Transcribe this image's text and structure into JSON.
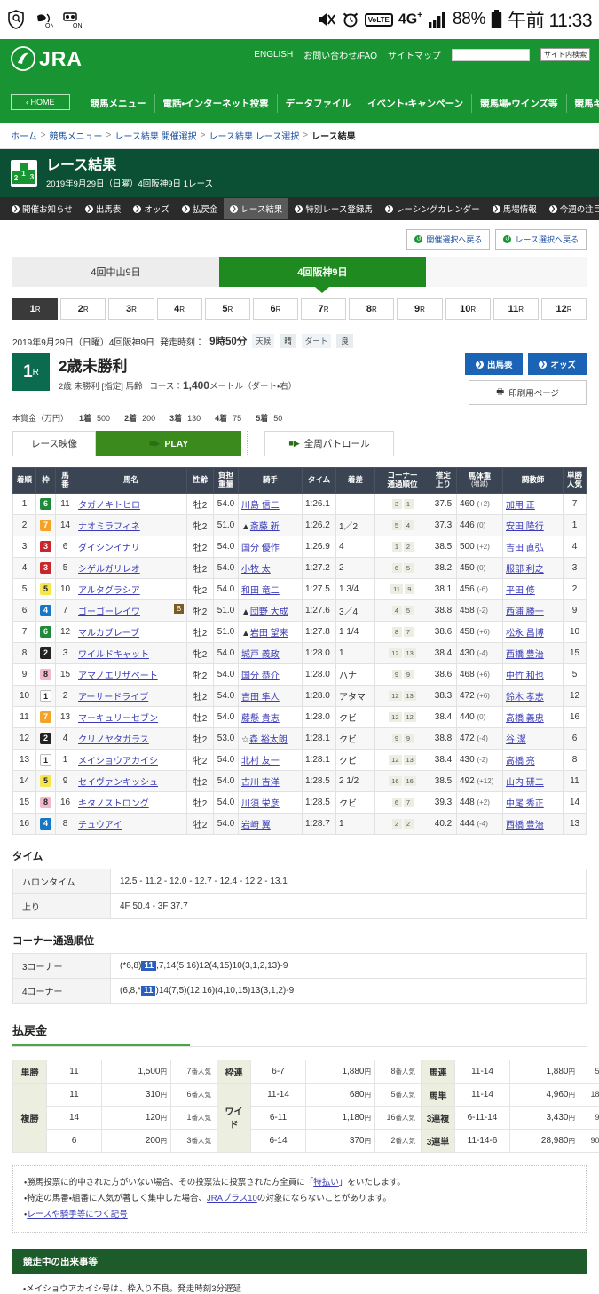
{
  "statusbar": {
    "icons": [
      "shield-vpn-icon",
      "vibrate-on-icon",
      "recording-on-icon"
    ],
    "mute_icon": "mute-icon",
    "alarm_icon": "alarm-icon",
    "volte_label": "VoLTE",
    "network_label": "4G+",
    "signal_icon": "signal-bars-icon",
    "battery_percent": "88%",
    "battery_icon": "battery-icon",
    "clock": "午前 11:33"
  },
  "header": {
    "logo_text": "JRA",
    "home_label": "HOME",
    "top_links": [
      "ENGLISH",
      "お問い合わせ/FAQ",
      "サイトマップ"
    ],
    "search_placeholder": "",
    "search_value": "",
    "search_button": "サイト内検索",
    "nav": [
      "競馬メニュー",
      "電話・インターネット投票",
      "データファイル",
      "イベント・キャンペーン",
      "競馬場・ウインズ等",
      "競馬ギャラリー"
    ]
  },
  "breadcrumb": {
    "items": [
      "ホーム",
      "競馬メニュー",
      "レース結果 開催選択",
      "レース結果 レース選択"
    ],
    "current": "レース結果"
  },
  "page": {
    "title": "レース結果",
    "subtitle": "2019年9月29日（日曜）4回阪神9日 1レース",
    "icon_digits": [
      "1",
      "2",
      "3"
    ]
  },
  "subnav": {
    "items": [
      {
        "label": "開催お知らせ",
        "active": false
      },
      {
        "label": "出馬表",
        "active": false
      },
      {
        "label": "オッズ",
        "active": false
      },
      {
        "label": "払戻金",
        "active": false
      },
      {
        "label": "レース結果",
        "active": true
      },
      {
        "label": "特別レース登録馬",
        "active": false
      },
      {
        "label": "レーシングカレンダー",
        "active": false
      },
      {
        "label": "馬場情報",
        "active": false
      },
      {
        "label": "今週の注目レース",
        "active": false
      }
    ]
  },
  "back_buttons": [
    {
      "label": "開催選択へ戻る"
    },
    {
      "label": "レース選択へ戻る"
    }
  ],
  "venue_tabs": [
    {
      "label": "4回中山9日",
      "active": false
    },
    {
      "label": "4回阪神9日",
      "active": true
    }
  ],
  "race_tabs": [
    {
      "num": "1",
      "suffix": "R",
      "active": true
    },
    {
      "num": "2",
      "suffix": "R",
      "active": false
    },
    {
      "num": "3",
      "suffix": "R",
      "active": false
    },
    {
      "num": "4",
      "suffix": "R",
      "active": false
    },
    {
      "num": "5",
      "suffix": "R",
      "active": false
    },
    {
      "num": "6",
      "suffix": "R",
      "active": false
    },
    {
      "num": "7",
      "suffix": "R",
      "active": false
    },
    {
      "num": "8",
      "suffix": "R",
      "active": false
    },
    {
      "num": "9",
      "suffix": "R",
      "active": false
    },
    {
      "num": "10",
      "suffix": "R",
      "active": false
    },
    {
      "num": "11",
      "suffix": "R",
      "active": false
    },
    {
      "num": "12",
      "suffix": "R",
      "active": false
    }
  ],
  "race": {
    "date_line": "2019年9月29日（日曜）4回阪神9日",
    "start_label": "発走時刻：",
    "start_time": "9時50分",
    "weather_label": "天候",
    "weather_value": "晴",
    "track_label": "ダート",
    "track_value": "良",
    "race_no": "1",
    "race_no_suffix": "R",
    "race_name": "2歳未勝利",
    "cond_prefix": "2歳 未勝利 [指定] 馬齢",
    "course_label": "コース：",
    "course_dist": "1,400",
    "course_unit": "メートル",
    "course_detail": "（ダート・右）",
    "btn_entries": "出馬表",
    "btn_odds": "オッズ",
    "btn_print": "印刷用ページ",
    "prize_label": "本賞金（万円）",
    "prizes": [
      {
        "place": "1着",
        "amount": "500"
      },
      {
        "place": "2着",
        "amount": "200"
      },
      {
        "place": "3着",
        "amount": "130"
      },
      {
        "place": "4着",
        "amount": "75"
      },
      {
        "place": "5着",
        "amount": "50"
      }
    ],
    "media_label": "レース映像",
    "play_label": "PLAY",
    "patrol_label": "全周パトロール"
  },
  "results_table": {
    "headers": [
      {
        "label": "着順"
      },
      {
        "label": "枠"
      },
      {
        "label": "馬番"
      },
      {
        "label": "馬名"
      },
      {
        "label": "性齢"
      },
      {
        "label": "負担重量"
      },
      {
        "label": "騎手"
      },
      {
        "label": "タイム"
      },
      {
        "label": "着差"
      },
      {
        "label": "コーナー通過順位"
      },
      {
        "label": "推定上り"
      },
      {
        "label": "馬体重",
        "sub": "(増減)"
      },
      {
        "label": "調教師"
      },
      {
        "label": "単勝人気"
      }
    ],
    "rows": [
      {
        "rank": "1",
        "waku": "6",
        "num": "11",
        "horse": "タガノキトヒロ",
        "blinker": "",
        "sex": "牡2",
        "weight": "54.0",
        "jockey": "川島 信二",
        "jockey_mark": "",
        "time": "1:26.1",
        "margin": "",
        "corners": [
          "3",
          "1"
        ],
        "last3f": "37.5",
        "hw": "460",
        "hwd": "(+2)",
        "trainer": "加用 正",
        "pop": "7"
      },
      {
        "rank": "2",
        "waku": "7",
        "num": "14",
        "horse": "ナオミラフィネ",
        "blinker": "",
        "sex": "牝2",
        "weight": "51.0",
        "jockey": "斎藤 新",
        "jockey_mark": "▲",
        "time": "1:26.2",
        "margin": "1／2",
        "corners": [
          "5",
          "4"
        ],
        "last3f": "37.3",
        "hw": "446",
        "hwd": "(0)",
        "trainer": "安田 隆行",
        "pop": "1"
      },
      {
        "rank": "3",
        "waku": "3",
        "num": "6",
        "horse": "ダイシンイナリ",
        "blinker": "",
        "sex": "牡2",
        "weight": "54.0",
        "jockey": "国分 優作",
        "jockey_mark": "",
        "time": "1:26.9",
        "margin": "4",
        "corners": [
          "1",
          "2"
        ],
        "last3f": "38.5",
        "hw": "500",
        "hwd": "(+2)",
        "trainer": "吉田 直弘",
        "pop": "4"
      },
      {
        "rank": "4",
        "waku": "3",
        "num": "5",
        "horse": "シゲルガリレオ",
        "blinker": "",
        "sex": "牡2",
        "weight": "54.0",
        "jockey": "小牧 太",
        "jockey_mark": "",
        "time": "1:27.2",
        "margin": "2",
        "corners": [
          "6",
          "5"
        ],
        "last3f": "38.2",
        "hw": "450",
        "hwd": "(0)",
        "trainer": "服部 利之",
        "pop": "3"
      },
      {
        "rank": "5",
        "waku": "5",
        "num": "10",
        "horse": "アルタグラシア",
        "blinker": "",
        "sex": "牝2",
        "weight": "54.0",
        "jockey": "和田 竜二",
        "jockey_mark": "",
        "time": "1:27.5",
        "margin": "1 3/4",
        "corners": [
          "11",
          "9"
        ],
        "last3f": "38.1",
        "hw": "456",
        "hwd": "(-6)",
        "trainer": "平田 修",
        "pop": "2"
      },
      {
        "rank": "6",
        "waku": "4",
        "num": "7",
        "horse": "ゴーゴーレイワ",
        "blinker": "B",
        "sex": "牝2",
        "weight": "51.0",
        "jockey": "団野 大成",
        "jockey_mark": "▲",
        "time": "1:27.6",
        "margin": "3／4",
        "corners": [
          "4",
          "5"
        ],
        "last3f": "38.8",
        "hw": "458",
        "hwd": "(-2)",
        "trainer": "西浦 勝一",
        "pop": "9"
      },
      {
        "rank": "7",
        "waku": "6",
        "num": "12",
        "horse": "マルカブレーブ",
        "blinker": "",
        "sex": "牡2",
        "weight": "51.0",
        "jockey": "岩田 望来",
        "jockey_mark": "▲",
        "time": "1:27.8",
        "margin": "1 1/4",
        "corners": [
          "8",
          "7"
        ],
        "last3f": "38.6",
        "hw": "458",
        "hwd": "(+6)",
        "trainer": "松永 昌博",
        "pop": "10"
      },
      {
        "rank": "8",
        "waku": "2",
        "num": "3",
        "horse": "ワイルドキャット",
        "blinker": "",
        "sex": "牝2",
        "weight": "54.0",
        "jockey": "城戸 義政",
        "jockey_mark": "",
        "time": "1:28.0",
        "margin": "1",
        "corners": [
          "12",
          "13"
        ],
        "last3f": "38.4",
        "hw": "430",
        "hwd": "(-4)",
        "trainer": "西橋 豊治",
        "pop": "15"
      },
      {
        "rank": "9",
        "waku": "8",
        "num": "15",
        "horse": "アマノエリザベート",
        "blinker": "",
        "sex": "牝2",
        "weight": "54.0",
        "jockey": "国分 恭介",
        "jockey_mark": "",
        "time": "1:28.0",
        "margin": "ハナ",
        "corners": [
          "9",
          "9"
        ],
        "last3f": "38.6",
        "hw": "468",
        "hwd": "(+6)",
        "trainer": "中竹 和也",
        "pop": "5"
      },
      {
        "rank": "10",
        "waku": "1",
        "num": "2",
        "horse": "アーサードライブ",
        "blinker": "",
        "sex": "牡2",
        "weight": "54.0",
        "jockey": "吉田 隼人",
        "jockey_mark": "",
        "time": "1:28.0",
        "margin": "アタマ",
        "corners": [
          "12",
          "13"
        ],
        "last3f": "38.3",
        "hw": "472",
        "hwd": "(+6)",
        "trainer": "鈴木 孝志",
        "pop": "12"
      },
      {
        "rank": "11",
        "waku": "7",
        "num": "13",
        "horse": "マーキュリーセブン",
        "blinker": "",
        "sex": "牡2",
        "weight": "54.0",
        "jockey": "藤懸 貴志",
        "jockey_mark": "",
        "time": "1:28.0",
        "margin": "クビ",
        "corners": [
          "12",
          "12"
        ],
        "last3f": "38.4",
        "hw": "440",
        "hwd": "(0)",
        "trainer": "高橋 義忠",
        "pop": "16"
      },
      {
        "rank": "12",
        "waku": "2",
        "num": "4",
        "horse": "クリノヤタガラス",
        "blinker": "",
        "sex": "牡2",
        "weight": "53.0",
        "jockey": "森 裕太朗",
        "jockey_mark": "☆",
        "time": "1:28.1",
        "margin": "クビ",
        "corners": [
          "9",
          "9"
        ],
        "last3f": "38.8",
        "hw": "472",
        "hwd": "(-4)",
        "trainer": "谷 潔",
        "pop": "6"
      },
      {
        "rank": "13",
        "waku": "1",
        "num": "1",
        "horse": "メイショウアカイシ",
        "blinker": "",
        "sex": "牝2",
        "weight": "54.0",
        "jockey": "北村 友一",
        "jockey_mark": "",
        "time": "1:28.1",
        "margin": "クビ",
        "corners": [
          "12",
          "13"
        ],
        "last3f": "38.4",
        "hw": "430",
        "hwd": "(-2)",
        "trainer": "高橋 亮",
        "pop": "8"
      },
      {
        "rank": "14",
        "waku": "5",
        "num": "9",
        "horse": "セイヴァンキッシュ",
        "blinker": "",
        "sex": "牡2",
        "weight": "54.0",
        "jockey": "古川 吉洋",
        "jockey_mark": "",
        "time": "1:28.5",
        "margin": "2 1/2",
        "corners": [
          "16",
          "16"
        ],
        "last3f": "38.5",
        "hw": "492",
        "hwd": "(+12)",
        "trainer": "山内 研二",
        "pop": "11"
      },
      {
        "rank": "15",
        "waku": "8",
        "num": "16",
        "horse": "キタノストロング",
        "blinker": "",
        "sex": "牡2",
        "weight": "54.0",
        "jockey": "川須 栄彦",
        "jockey_mark": "",
        "time": "1:28.5",
        "margin": "クビ",
        "corners": [
          "6",
          "7"
        ],
        "last3f": "39.3",
        "hw": "448",
        "hwd": "(+2)",
        "trainer": "中尾 秀正",
        "pop": "14"
      },
      {
        "rank": "16",
        "waku": "4",
        "num": "8",
        "horse": "チュウアイ",
        "blinker": "",
        "sex": "牡2",
        "weight": "54.0",
        "jockey": "岩崎 翼",
        "jockey_mark": "",
        "time": "1:28.7",
        "margin": "1",
        "corners": [
          "2",
          "2"
        ],
        "last3f": "40.2",
        "hw": "444",
        "hwd": "(-4)",
        "trainer": "西橋 豊治",
        "pop": "13"
      }
    ]
  },
  "time_section": {
    "heading": "タイム",
    "rows": [
      {
        "key": "ハロンタイム",
        "value": "12.5 - 11.2 - 12.0 - 12.7 - 12.4 - 12.2 - 13.1"
      },
      {
        "key": "上り",
        "value": "4F 50.4 - 3F 37.7"
      }
    ]
  },
  "corner_section": {
    "heading": "コーナー通過順位",
    "rows": [
      {
        "key": "3コーナー",
        "pre": "(*6,8)",
        "hl": "11",
        "post": ",7,14(5,16)12(4,15)10(3,1,2,13)-9"
      },
      {
        "key": "4コーナー",
        "pre": "(6,8,*",
        "hl": "11",
        "post": ")14(7,5)(12,16)(4,10,15)13(3,1,2)-9"
      }
    ]
  },
  "payout": {
    "heading": "払戻金",
    "yen_unit": "円",
    "pop_unit": "番人気",
    "groups": [
      {
        "label": "単勝",
        "rows": [
          {
            "combo": "11",
            "amount": "1,500",
            "pop": "7"
          }
        ]
      },
      {
        "label": "複勝",
        "rows": [
          {
            "combo": "11",
            "amount": "310",
            "pop": "6"
          },
          {
            "combo": "14",
            "amount": "120",
            "pop": "1"
          },
          {
            "combo": "6",
            "amount": "200",
            "pop": "3"
          }
        ]
      },
      {
        "label": "枠連",
        "rows": [
          {
            "combo": "6-7",
            "amount": "1,880",
            "pop": "8"
          }
        ]
      },
      {
        "label": "ワイド",
        "rows": [
          {
            "combo": "11-14",
            "amount": "680",
            "pop": "5"
          },
          {
            "combo": "6-11",
            "amount": "1,180",
            "pop": "16"
          },
          {
            "combo": "6-14",
            "amount": "370",
            "pop": "2"
          }
        ]
      },
      {
        "label": "馬連",
        "rows": [
          {
            "combo": "11-14",
            "amount": "1,880",
            "pop": "5"
          }
        ]
      },
      {
        "label": "馬単",
        "rows": [
          {
            "combo": "11-14",
            "amount": "4,960",
            "pop": "18"
          }
        ]
      },
      {
        "label": "3連複",
        "rows": [
          {
            "combo": "6-11-14",
            "amount": "3,430",
            "pop": "9"
          }
        ]
      },
      {
        "label": "3連単",
        "rows": [
          {
            "combo": "11-14-6",
            "amount": "28,980",
            "pop": "90"
          }
        ]
      }
    ]
  },
  "notes": [
    {
      "pre": "・勝馬投票に的中された方がいない場合、その投票法に投票された方全員に「",
      "link": "特払い",
      "post": "」をいたします。"
    },
    {
      "pre": "・特定の馬番・組番に人気が著しく集中した場合、",
      "link": "JRAプラス10",
      "post": "の対象にならないことがあります。"
    },
    {
      "pre": "・",
      "link": "レースや騎手等につく記号",
      "post": ""
    }
  ],
  "events": {
    "heading": "競走中の出来事等",
    "first_line": "・メイショウアカイシ号は、枠入り不良。発走時刻3分遅延"
  }
}
